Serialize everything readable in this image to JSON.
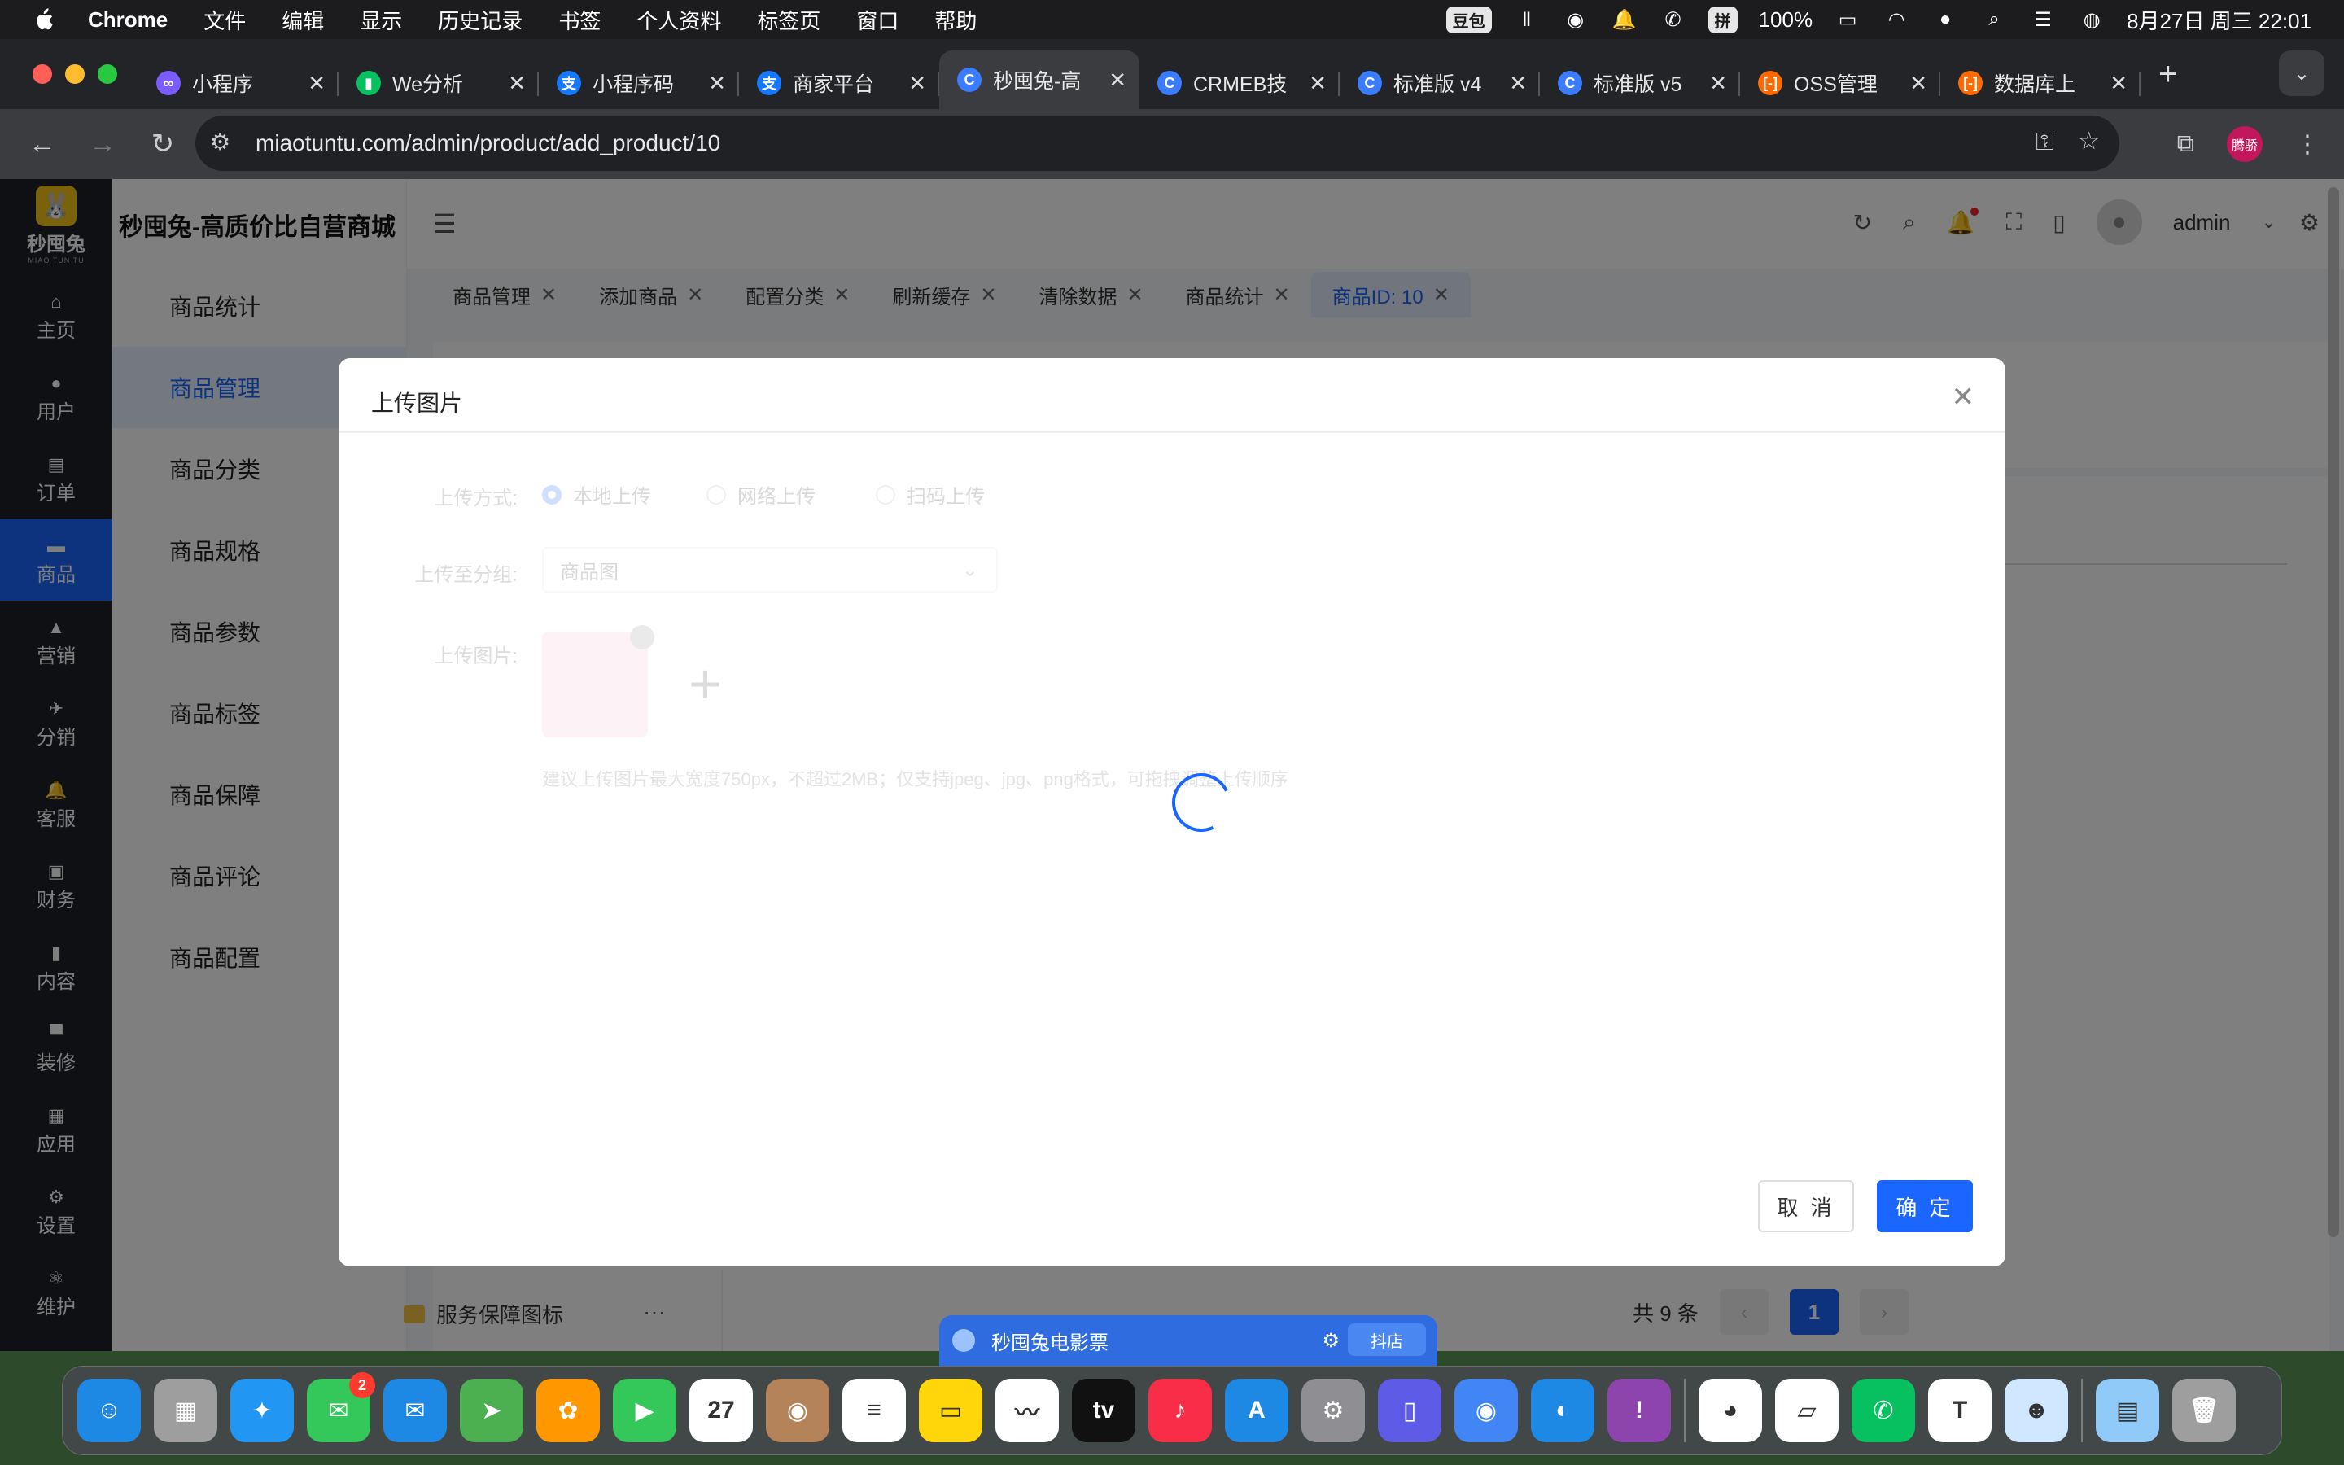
{
  "menubar": {
    "app": "Chrome",
    "items": [
      "文件",
      "编辑",
      "显示",
      "历史记录",
      "书签",
      "个人资料",
      "标签页",
      "窗口",
      "帮助"
    ],
    "doubao": "豆包",
    "pinyin": "拼",
    "battery": "100%",
    "datetime": "8月27日 周三  22:01"
  },
  "tabs": [
    {
      "label": "小程序",
      "fav_color": "#7b5cff",
      "fav": "∞"
    },
    {
      "label": "We分析",
      "fav_color": "#07c160",
      "fav": "▮"
    },
    {
      "label": "小程序码",
      "fav_color": "#1677ff",
      "fav": "支"
    },
    {
      "label": "商家平台",
      "fav_color": "#1677ff",
      "fav": "支"
    },
    {
      "label": "秒囤兔-高",
      "fav_color": "#3a7bff",
      "fav": "C",
      "active": true
    },
    {
      "label": "CRMEB技",
      "fav_color": "#3a7bff",
      "fav": "C"
    },
    {
      "label": "标准版 v4",
      "fav_color": "#3a7bff",
      "fav": "C"
    },
    {
      "label": "标准版 v5",
      "fav_color": "#3a7bff",
      "fav": "C"
    },
    {
      "label": "OSS管理",
      "fav_color": "#ff6a00",
      "fav": "[-]"
    },
    {
      "label": "数据库上",
      "fav_color": "#ff6a00",
      "fav": "[-]"
    }
  ],
  "address": {
    "url": "miaotuntu.com/admin/product/add_product/10",
    "profile": "腾骄"
  },
  "logo": {
    "text": "秒囤兔",
    "sub": "MIAO TUN TU"
  },
  "brand": "秒囤兔-高质价比自营商城",
  "main_menu": [
    "主页",
    "用户",
    "订单",
    "商品",
    "营销",
    "分销",
    "客服",
    "财务",
    "内容",
    "装修",
    "应用",
    "设置",
    "维护"
  ],
  "main_menu_active": 3,
  "sub_menu": [
    "商品统计",
    "商品管理",
    "商品分类",
    "商品规格",
    "商品参数",
    "商品标签",
    "商品保障",
    "商品评论",
    "商品配置"
  ],
  "sub_menu_active": 1,
  "header": {
    "user": "admin"
  },
  "page_tags": [
    {
      "label": "商品管理"
    },
    {
      "label": "添加商品"
    },
    {
      "label": "配置分类"
    },
    {
      "label": "刷新缓存"
    },
    {
      "label": "清除数据"
    },
    {
      "label": "商品统计"
    },
    {
      "label": "商品ID: 10",
      "active": true
    }
  ],
  "modal": {
    "title": "上传图片",
    "upload_method_label": "上传方式:",
    "methods": [
      "本地上传",
      "网络上传",
      "扫码上传"
    ],
    "group_label": "上传至分组:",
    "group_value": "商品图",
    "image_label": "上传图片:",
    "tip": "建议上传图片最大宽度750px，不超过2MB；仅支持jpeg、jpg、png格式，可拖拽调整上传顺序",
    "cancel": "取 消",
    "ok": "确 定"
  },
  "bottom": {
    "folder": "服务保障图标",
    "total": "共 9 条",
    "page": "1"
  },
  "float_bar": {
    "title": "秒囤兔电影票",
    "badge": "抖店"
  },
  "dock": {
    "apps": [
      {
        "name": "finder",
        "color": "#1e88e5",
        "glyph": "☺"
      },
      {
        "name": "launchpad",
        "color": "#9e9e9e",
        "glyph": "▦"
      },
      {
        "name": "safari",
        "color": "#2196f3",
        "glyph": "✦"
      },
      {
        "name": "messages",
        "color": "#34c759",
        "glyph": "✉",
        "badge": "2"
      },
      {
        "name": "mail",
        "color": "#1e88e5",
        "glyph": "✉"
      },
      {
        "name": "maps",
        "color": "#4caf50",
        "glyph": "➤"
      },
      {
        "name": "photos",
        "color": "#ff9800",
        "glyph": "✿"
      },
      {
        "name": "facetime",
        "color": "#34c759",
        "glyph": "▶"
      },
      {
        "name": "calendar",
        "color": "#ffffff",
        "glyph": "27"
      },
      {
        "name": "contacts",
        "color": "#b5835a",
        "glyph": "◉"
      },
      {
        "name": "reminders",
        "color": "#ffffff",
        "glyph": "≡"
      },
      {
        "name": "notes",
        "color": "#ffd60a",
        "glyph": "▭"
      },
      {
        "name": "freeform",
        "color": "#ffffff",
        "glyph": "〰"
      },
      {
        "name": "tv",
        "color": "#111111",
        "glyph": "tv"
      },
      {
        "name": "music",
        "color": "#fa2d48",
        "glyph": "♪"
      },
      {
        "name": "app-store",
        "color": "#1e88e5",
        "glyph": "A"
      },
      {
        "name": "system-settings",
        "color": "#8e8e93",
        "glyph": "⚙"
      },
      {
        "name": "iphone-mirroring",
        "color": "#5e5ce6",
        "glyph": "▯"
      },
      {
        "name": "chrome",
        "color": "#4285f4",
        "glyph": "◉"
      },
      {
        "name": "browser",
        "color": "#1e88e5",
        "glyph": "◐"
      },
      {
        "name": "feedback",
        "color": "#8e44ad",
        "glyph": "!"
      },
      {
        "name": "qq",
        "color": "#ffffff",
        "glyph": "◕"
      },
      {
        "name": "doudian",
        "color": "#ffffff",
        "glyph": "▱"
      },
      {
        "name": "wechat",
        "color": "#07c160",
        "glyph": "✆"
      },
      {
        "name": "tencent-meeting",
        "color": "#ffffff",
        "glyph": "T"
      },
      {
        "name": "avatar-app",
        "color": "#cfe8ff",
        "glyph": "☻"
      },
      {
        "name": "preview",
        "color": "#90caf9",
        "glyph": "▤"
      },
      {
        "name": "trash",
        "color": "#9e9e9e",
        "glyph": "🗑"
      }
    ]
  }
}
